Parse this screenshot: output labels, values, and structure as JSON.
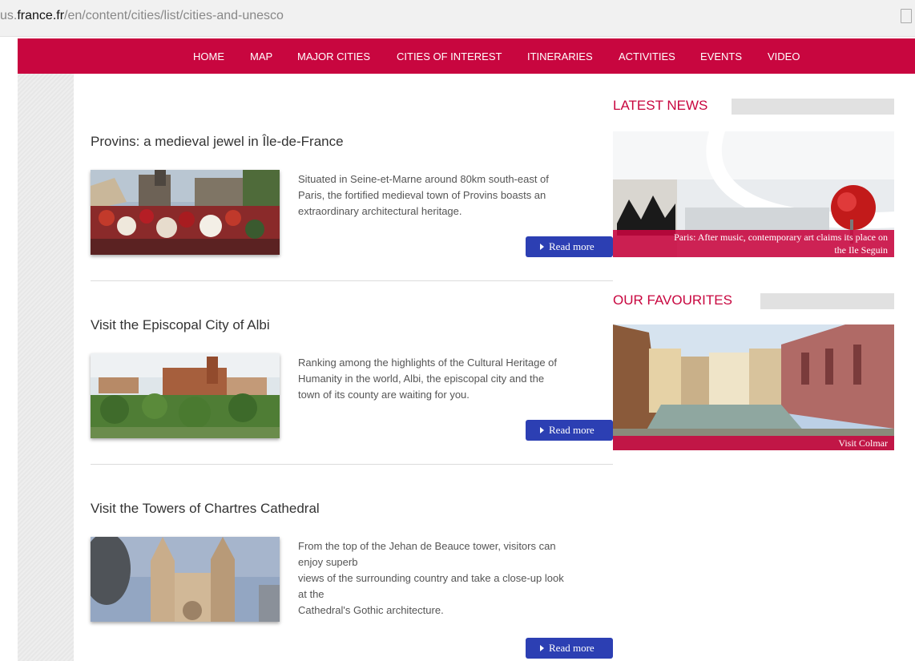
{
  "url": {
    "prefix": "us.",
    "host": "france.fr",
    "path": "/en/content/cities/list/cities-and-unesco"
  },
  "nav": {
    "items": [
      "HOME",
      "MAP",
      "MAJOR CITIES",
      "CITIES OF INTEREST",
      "ITINERARIES",
      "ACTIVITIES",
      "EVENTS",
      "VIDEO"
    ]
  },
  "articles": [
    {
      "title": "Provins: a medieval jewel in Île-de-France",
      "desc_lines": [
        "Situated in Seine-et-Marne around 80km south-east of",
        "Paris, the fortified medieval town of Provins boasts an",
        "extraordinary architectural heritage."
      ],
      "read_more": "Read more"
    },
    {
      "title": "Visit the Episcopal City of Albi",
      "desc_lines": [
        "Ranking among the highlights of the Cultural Heritage of",
        "Humanity in the world, Albi, the episcopal city and the",
        "town of its county are waiting for you."
      ],
      "read_more": "Read more"
    },
    {
      "title": "Visit the Towers of Chartres Cathedral",
      "desc_lines": [
        "From the top of the Jehan de Beauce tower, visitors can",
        "enjoy superb",
        "views of the surrounding country and take a close-up look",
        "at the",
        "Cathedral's Gothic architecture."
      ],
      "read_more": "Read more"
    }
  ],
  "sidebar": {
    "latest_news": {
      "heading": "LATEST NEWS",
      "caption_line1": "Paris: After music, contemporary art claims its place on",
      "caption_line2": "the Ile Seguin"
    },
    "favourites": {
      "heading": "OUR FAVOURITES",
      "caption": "Visit Colmar"
    }
  },
  "colors": {
    "brand": "#c8063f",
    "button": "#2c3fb3"
  }
}
